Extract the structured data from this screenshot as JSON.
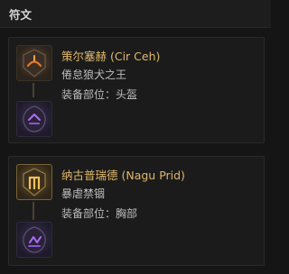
{
  "panel": {
    "title": "符文"
  },
  "runes": [
    {
      "name": "策尔塞赫 (Cir Ceh)",
      "subtitle": "倦怠狼犬之王",
      "slot_text": "装备部位：头盔",
      "rune_icon": "rune-orange-glyph-icon",
      "socket_icon": "socket-purple-glyph-icon"
    },
    {
      "name": "纳古普瑞德 (Nagu Prid)",
      "subtitle": "暴虐禁锢",
      "slot_text": "装备部位：胸部",
      "rune_icon": "rune-gold-glyph-icon",
      "socket_icon": "socket-purple-glyph-icon"
    }
  ],
  "colors": {
    "name": "#e0b86b",
    "text": "#bdbdbd",
    "background": "#151515",
    "card": "#1b1b1b"
  }
}
